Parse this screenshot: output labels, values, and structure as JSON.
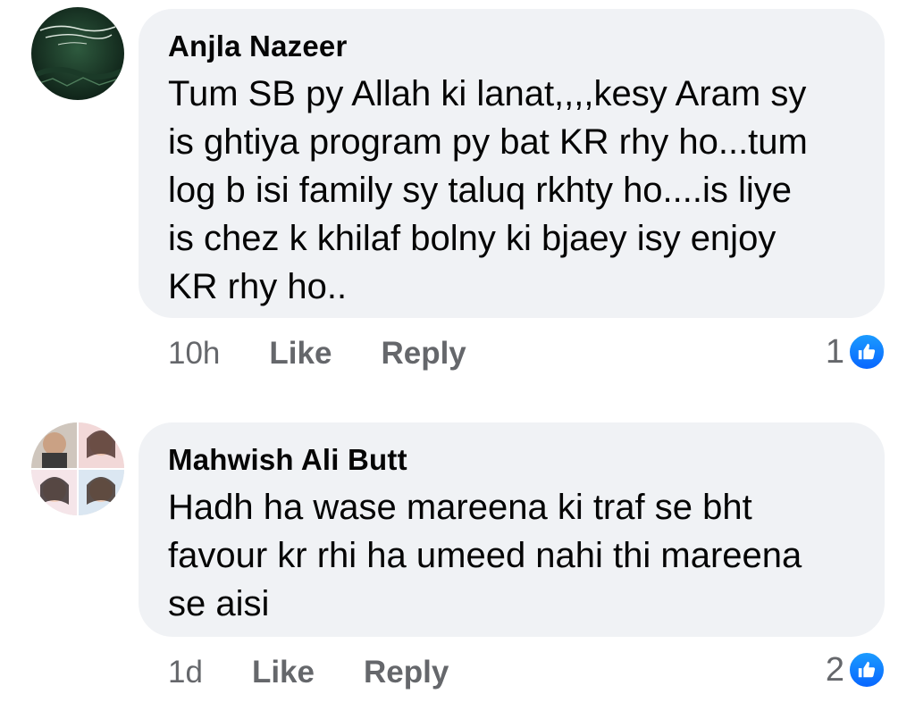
{
  "comments": [
    {
      "author": "Anjla Nazeer",
      "text": "Tum SB py Allah ki lanat,,,,kesy Aram sy\nis ghtiya program py bat KR rhy ho...tum\nlog b isi family sy taluq rkhty ho....is liye\nis chez k khilaf bolny ki bjaey isy enjoy\nKR rhy ho..",
      "time": "10h",
      "like_label": "Like",
      "reply_label": "Reply",
      "reaction_count": "1",
      "avatar_icon": "profile-photo-green-calligraphy"
    },
    {
      "author": "Mahwish Ali Butt",
      "text": "Hadh ha wase mareena ki traf se bht\nfavour kr rhi ha umeed nahi thi mareena\nse aisi",
      "time": "1d",
      "like_label": "Like",
      "reply_label": "Reply",
      "reaction_count": "2",
      "avatar_icon": "profile-photo-collage"
    }
  ],
  "colors": {
    "bubble": "#f0f2f5",
    "meta_text": "#65676b",
    "like_blue": "#0866ff"
  }
}
